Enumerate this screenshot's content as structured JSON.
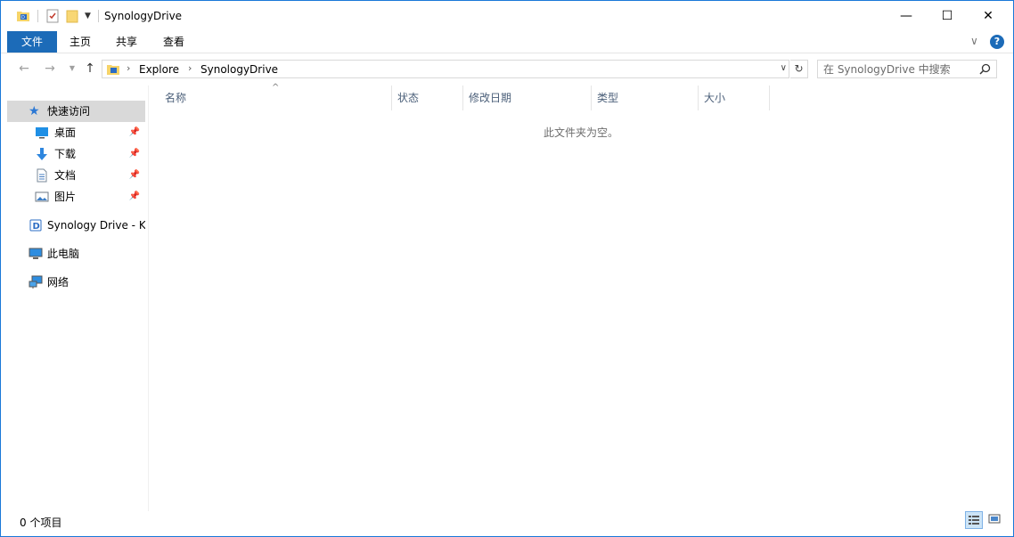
{
  "window": {
    "title": "SynologyDrive",
    "minimize_glyph": "—",
    "maximize_glyph": "☐",
    "close_glyph": "✕"
  },
  "ribbon": {
    "tabs": [
      {
        "label": "文件",
        "active": true
      },
      {
        "label": "主页"
      },
      {
        "label": "共享"
      },
      {
        "label": "查看"
      }
    ],
    "expand_glyph": "∨",
    "help_glyph": "?"
  },
  "address": {
    "breadcrumbs": [
      "Explore",
      "SynologyDrive"
    ],
    "search_placeholder": "在 SynologyDrive 中搜索"
  },
  "nav": {
    "quick_access": "快速访问",
    "pinned": [
      {
        "label": "桌面",
        "icon": "desktop-icon"
      },
      {
        "label": "下载",
        "icon": "download-icon"
      },
      {
        "label": "文档",
        "icon": "document-icon"
      },
      {
        "label": "图片",
        "icon": "pictures-icon"
      }
    ],
    "synology": "Synology Drive - KE",
    "this_pc": "此电脑",
    "network": "网络"
  },
  "columns": [
    "名称",
    "状态",
    "修改日期",
    "类型",
    "大小"
  ],
  "empty_message": "此文件夹为空。",
  "status": {
    "item_count": "0 个项目"
  },
  "colors": {
    "accent": "#1c6bb8",
    "selected": "#d9d9d9",
    "header_text": "#4c607a"
  }
}
